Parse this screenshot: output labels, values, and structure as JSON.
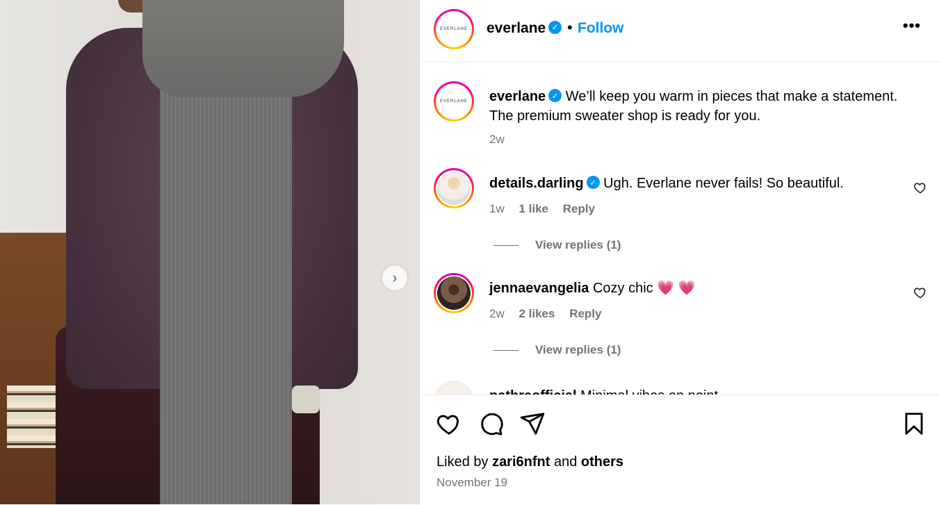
{
  "post": {
    "image_alt": "Person wearing a purple cable-knit cardigan and a long grey scarf",
    "next_icon": "chevron-right-icon"
  },
  "header": {
    "username": "everlane",
    "avatar_text": "EVERLANE",
    "dot": "•",
    "follow_label": "Follow",
    "more_label": "•••"
  },
  "caption": {
    "username": "everlane",
    "text": "We’ll keep you warm in pieces that make a statement. The premium sweater shop is ready for you.",
    "time": "2w"
  },
  "comments": [
    {
      "username": "details.darling",
      "verified": true,
      "text": "Ugh. Everlane never fails! So beautiful.",
      "time": "1w",
      "likes": "1 like",
      "reply": "Reply",
      "view_replies": "View replies (1)"
    },
    {
      "username": "jennaevangelia",
      "verified": false,
      "text": "Cozy chic 💗 💗",
      "time": "2w",
      "likes": "2 likes",
      "reply": "Reply",
      "view_replies": "View replies (1)"
    },
    {
      "username": "pathraofficial",
      "verified": false,
      "text": "Minimal vibes on point"
    }
  ],
  "footer": {
    "liked_prefix": "Liked by",
    "liked_user": "zari6nfnt",
    "liked_and": "and",
    "liked_others": "others",
    "date": "November 19"
  },
  "colors": {
    "accent": "#0095f6",
    "muted": "#737373"
  }
}
